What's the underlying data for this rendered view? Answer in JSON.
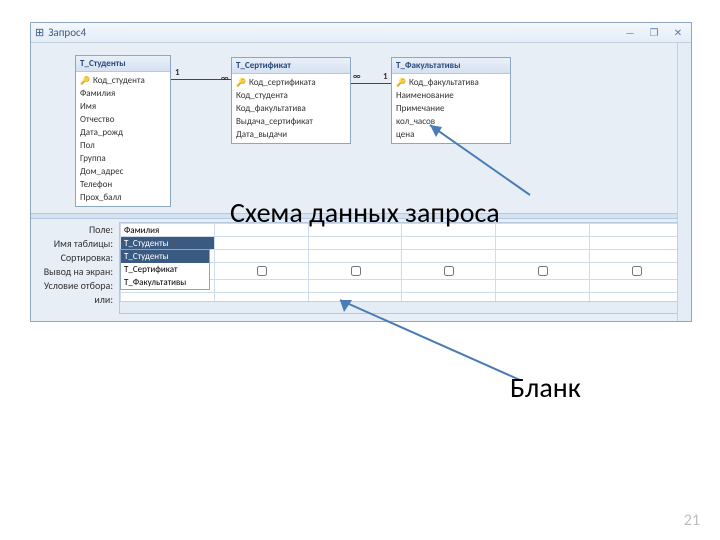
{
  "titlebar": {
    "icon_label": "⊞",
    "title": "Запрос4",
    "min": "—",
    "max": "❐",
    "close": "✕"
  },
  "tables": {
    "t1": {
      "caption": "Т_Студенты",
      "fields": [
        "Код_студента",
        "Фамилия",
        "Имя",
        "Отчество",
        "Дата_рожд",
        "Пол",
        "Группа",
        "Дом_адрес",
        "Телефон",
        "Прох_балл"
      ],
      "key_index": 0
    },
    "t2": {
      "caption": "Т_Сертификат",
      "fields": [
        "Код_сертификата",
        "Код_студента",
        "Код_факультатива",
        "Выдача_сертификат",
        "Дата_выдачи"
      ],
      "key_index": 0
    },
    "t3": {
      "caption": "Т_Факультативы",
      "fields": [
        "Код_факультатива",
        "Наименование",
        "Примечание",
        "кол_часов",
        "цена"
      ],
      "key_index": 0
    }
  },
  "relations": {
    "one": "1",
    "many": "∞"
  },
  "grid_labels": {
    "field": "Поле:",
    "table": "Имя таблицы:",
    "sort": "Сортировка:",
    "show": "Вывод на экран:",
    "criteria": "Условие отбора:",
    "or": "или:"
  },
  "grid_values": {
    "col1_field": "Фамилия",
    "col1_table": "Т_Студенты",
    "popup": [
      "Т_Студенты",
      "Т_Сертификат",
      "Т_Факультативы"
    ]
  },
  "callouts": {
    "schema": "Схема данных запроса",
    "blank": "Бланк"
  },
  "page_number": "21"
}
